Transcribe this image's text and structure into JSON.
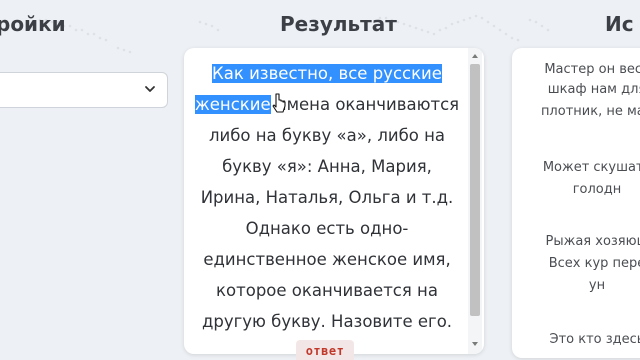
{
  "headings": {
    "settings": "ройки",
    "result": "Результат",
    "source": "Ис"
  },
  "result": {
    "highlighted_line1": "Как известно, все русские",
    "highlighted_line2": "женские",
    "rest_line2": " имена оканчиваются",
    "lines": [
      "либо на букву «а», либо на",
      "букву «я»: Анна, Мария,",
      "Ирина, Наталья, Ольга и т.д.",
      "Однако есть одно-",
      "единственное женское имя,",
      "которое оканчивается на",
      "другую букву. Назовите его."
    ],
    "answer_button": "ответ"
  },
  "source": {
    "lines": [
      "Мастер он весь",
      "шкаф нам для",
      "плотник, не мал",
      "Может скушать",
      "голодн",
      "Рыжая хозяюш",
      "Всех кур пере",
      "ун",
      "Это кто здесь"
    ]
  },
  "colors": {
    "selection": "#3390ff",
    "answer_text": "#c0392b",
    "background": "#edf0f4"
  },
  "icons": [
    "chevron-down-icon",
    "text-cursor-icon",
    "world-map-dots"
  ]
}
